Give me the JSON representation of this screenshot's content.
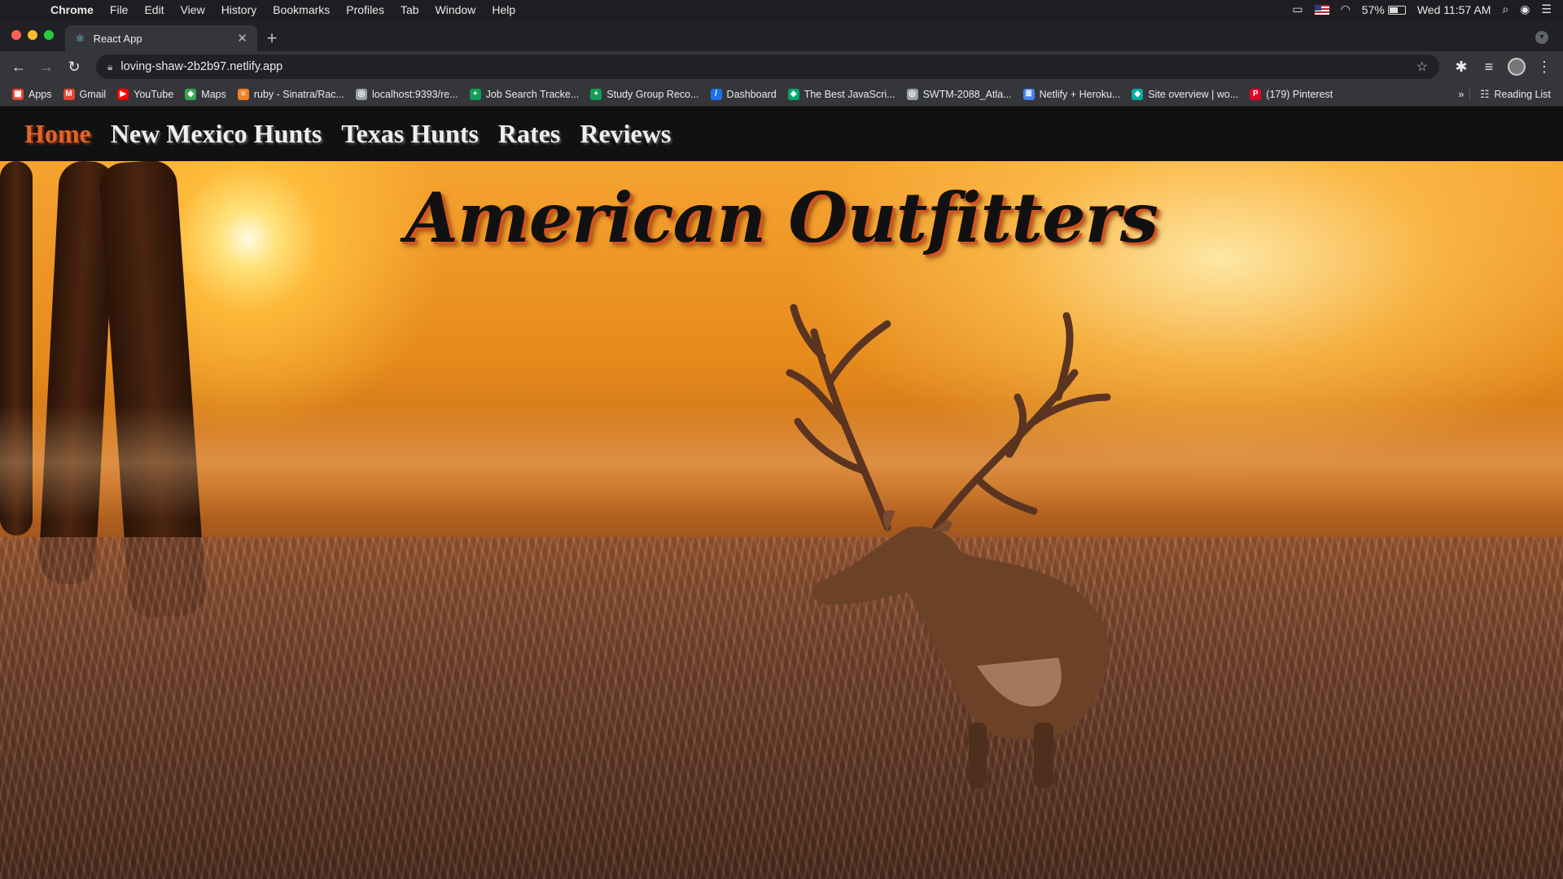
{
  "menubar": {
    "app": "Chrome",
    "items": [
      "File",
      "Edit",
      "View",
      "History",
      "Bookmarks",
      "Profiles",
      "Tab",
      "Window",
      "Help"
    ],
    "battery": "57%",
    "clock": "Wed 11:57 AM"
  },
  "browser": {
    "tab_title": "React App",
    "url": "loving-shaw-2b2b97.netlify.app",
    "bookmarks": [
      {
        "label": "Apps",
        "icon": "apps-grid-icon",
        "color": "#ea4335"
      },
      {
        "label": "Gmail",
        "icon": "gmail-icon",
        "color": "#ea4335"
      },
      {
        "label": "YouTube",
        "icon": "youtube-icon",
        "color": "#ff0000"
      },
      {
        "label": "Maps",
        "icon": "maps-icon",
        "color": "#34a853"
      },
      {
        "label": "ruby - Sinatra/Rac...",
        "icon": "stackoverflow-icon",
        "color": "#f48024"
      },
      {
        "label": "localhost:9393/re...",
        "icon": "globe-icon",
        "color": "#9aa0a6"
      },
      {
        "label": "Job Search Tracke...",
        "icon": "sheets-icon",
        "color": "#0f9d58"
      },
      {
        "label": "Study Group Reco...",
        "icon": "sheets-icon",
        "color": "#0f9d58"
      },
      {
        "label": "Dashboard",
        "icon": "dashboard-icon",
        "color": "#1a73e8"
      },
      {
        "label": "The Best JavaScri...",
        "icon": "layers-icon",
        "color": "#00a86b"
      },
      {
        "label": "SWTM-2088_Atla...",
        "icon": "globe-icon",
        "color": "#9aa0a6"
      },
      {
        "label": "Netlify + Heroku...",
        "icon": "docs-icon",
        "color": "#4285f4"
      },
      {
        "label": "Site overview | wo...",
        "icon": "netlify-icon",
        "color": "#00ad9f"
      },
      {
        "label": "(179) Pinterest",
        "icon": "pinterest-icon",
        "color": "#e60023"
      }
    ],
    "reading_list": "Reading List"
  },
  "site": {
    "nav": [
      {
        "label": "Home",
        "active": true
      },
      {
        "label": "New Mexico Hunts",
        "active": false
      },
      {
        "label": "Texas Hunts",
        "active": false
      },
      {
        "label": "Rates",
        "active": false
      },
      {
        "label": "Reviews",
        "active": false
      }
    ],
    "hero_title": "American Outfitters",
    "accent_color": "#e0642a"
  }
}
